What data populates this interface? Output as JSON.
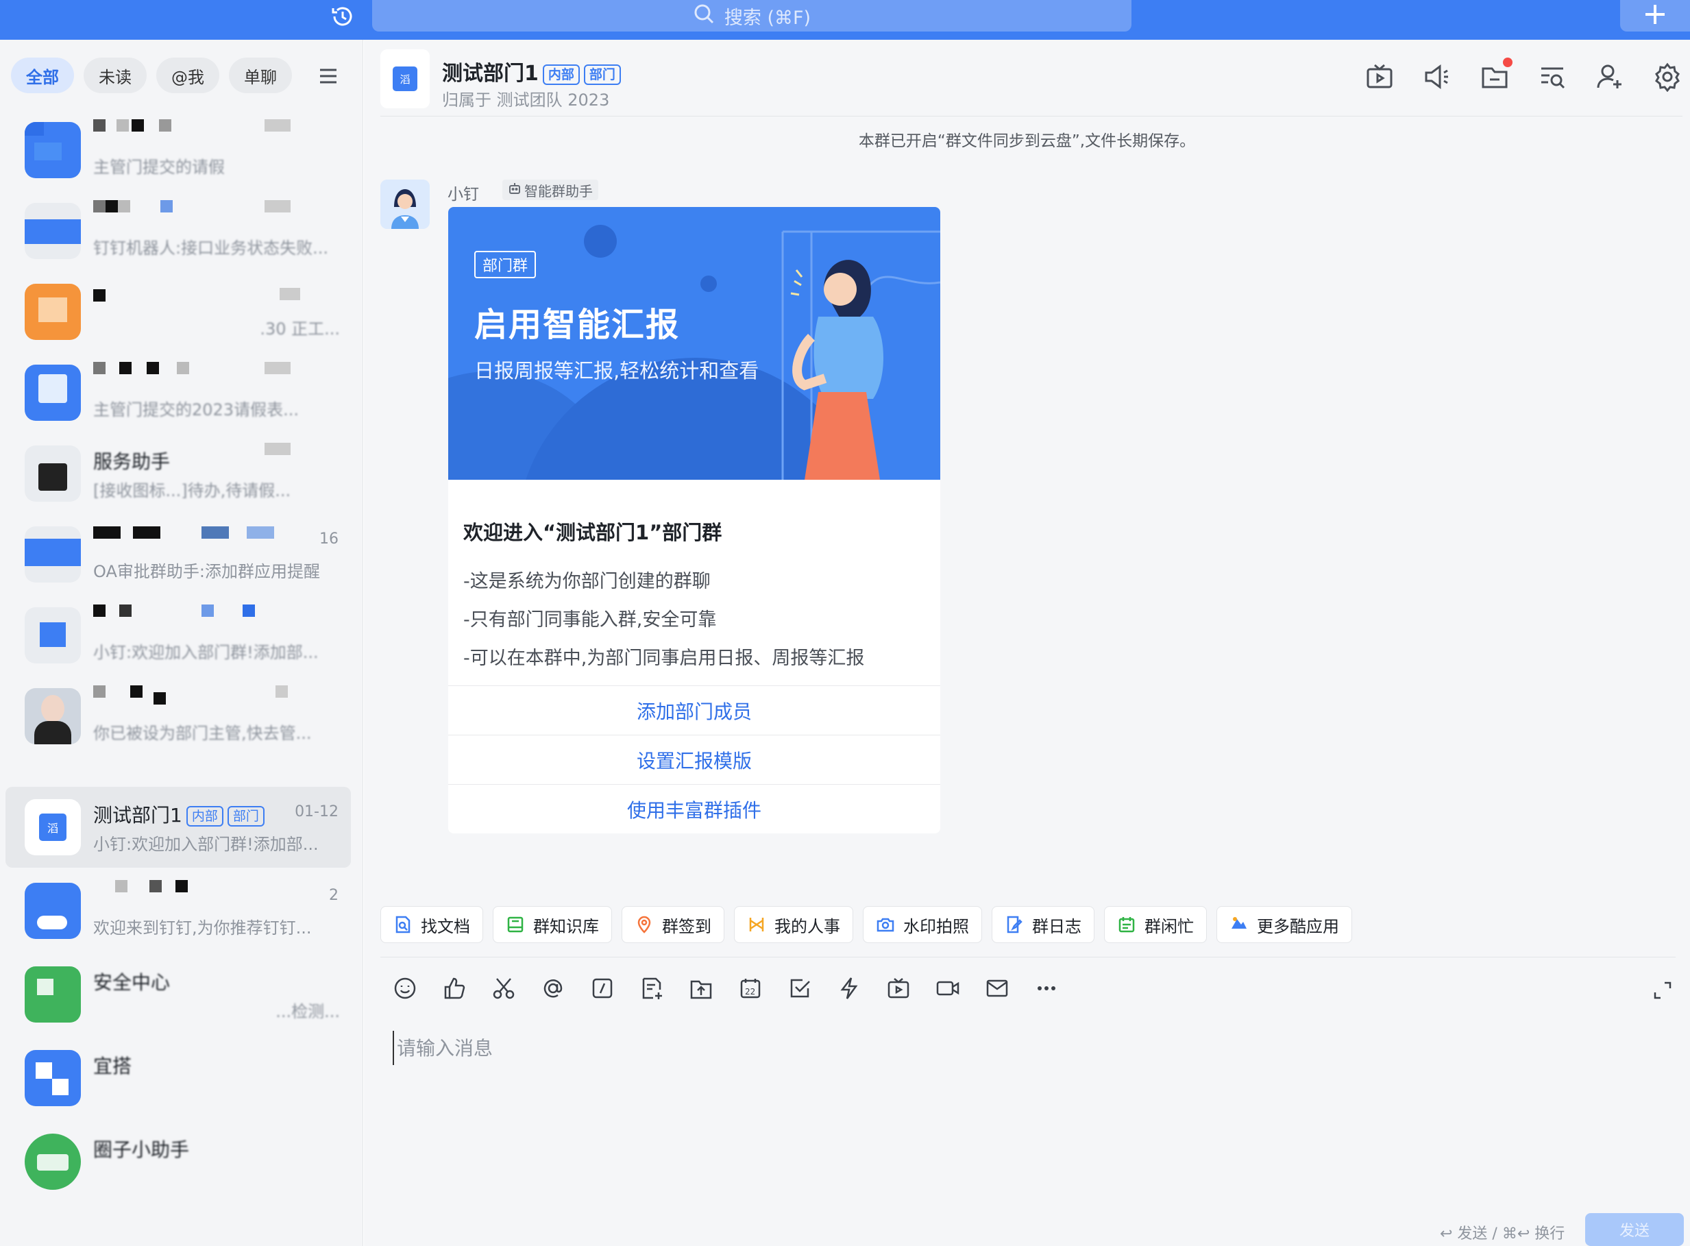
{
  "search": {
    "label": "搜索 (⌘F)"
  },
  "filters": [
    {
      "label": "全部",
      "active": true
    },
    {
      "label": "未读",
      "active": false
    },
    {
      "label": "@我",
      "active": false
    },
    {
      "label": "单聊",
      "active": false
    }
  ],
  "conversations": [
    {
      "sub": "主管门提交的请假"
    },
    {
      "sub": "钉钉机器人:接口业务状态失败..."
    },
    {
      "sub": ".30 正工..."
    },
    {
      "sub": "主管门提交的2023请假表..."
    },
    {
      "title": "服务助手",
      "sub": "[接收图标...]待办,待请假..."
    },
    {
      "time": "16",
      "sub": "OA审批群助手:添加群应用提醒"
    },
    {
      "sub": "小钉:欢迎加入部门群!添加部..."
    },
    {
      "sub": "你已被设为部门主管,快去管..."
    },
    {
      "title": "测试部门1",
      "tag1": "内部",
      "tag2": "部门",
      "time": "01-12",
      "sub": "小钉:欢迎加入部门群!添加部..."
    },
    {
      "time": "2",
      "sub": "欢迎来到钉钉,为你推荐钉钉..."
    },
    {
      "title": "安全中心",
      "sub": "...检测..."
    },
    {
      "title": "宜搭"
    },
    {
      "title": "圈子小助手"
    }
  ],
  "header": {
    "title": "测试部门1",
    "tag1": "内部",
    "tag2": "部门",
    "subtitle": "归属于 测试团队 2023",
    "avatar_text": "滔"
  },
  "system_message": "本群已开启“群文件同步到云盘”,文件长期保存。",
  "bot": {
    "name": "小钉",
    "badge": "智能群助手"
  },
  "card": {
    "banner_tag": "部门群",
    "banner_title": "启用智能汇报",
    "banner_sub": "日报周报等汇报,轻松统计和查看",
    "title": "欢迎进入“测试部门1”部门群",
    "lines": [
      "-这是系统为你部门创建的群聊",
      "-只有部门同事能入群,安全可靠",
      "-可以在本群中,为部门同事启用日报、周报等汇报"
    ],
    "buttons": [
      "添加部门成员",
      "设置汇报模版",
      "使用丰富群插件"
    ]
  },
  "apps": [
    {
      "label": "找文档",
      "icon": "doc-search-icon",
      "color": "#3d7ef3"
    },
    {
      "label": "群知识库",
      "icon": "knowledge-icon",
      "color": "#2fb344"
    },
    {
      "label": "群签到",
      "icon": "location-icon",
      "color": "#f5743b"
    },
    {
      "label": "我的人事",
      "icon": "hr-icon",
      "color": "#f5a623"
    },
    {
      "label": "水印拍照",
      "icon": "camera-icon",
      "color": "#3d7ef3"
    },
    {
      "label": "群日志",
      "icon": "log-icon",
      "color": "#3d7ef3"
    },
    {
      "label": "群闲忙",
      "icon": "calendar-icon",
      "color": "#2fb344"
    },
    {
      "label": "更多酷应用",
      "icon": "more-apps-icon",
      "color": "#3d7ef3"
    }
  ],
  "input": {
    "placeholder": "请输入消息"
  },
  "hint": "↩ 发送 / ⌘↩ 换行",
  "send": {
    "label": "发送"
  },
  "colors": {
    "accent": "#3d7ef3",
    "sidebar_bg": "#f4f5f7",
    "main_bg": "#f5f6f8"
  }
}
